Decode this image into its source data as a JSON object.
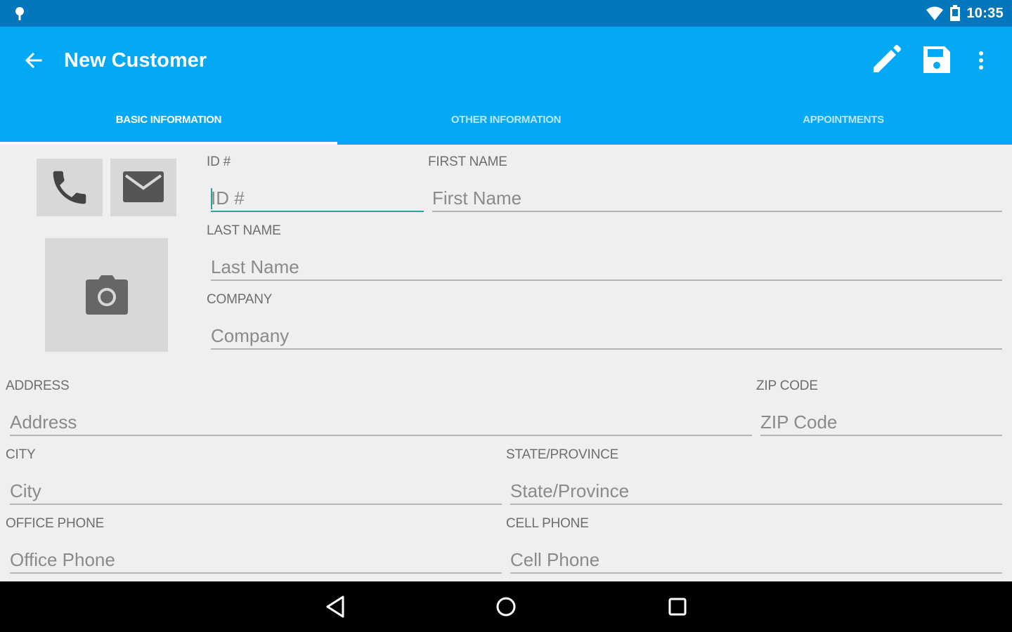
{
  "status_bar": {
    "time": "10:35",
    "icons": [
      "notification-pin-icon",
      "wifi-icon",
      "battery-icon"
    ]
  },
  "app_bar": {
    "title": "New Customer",
    "actions": [
      "back-arrow-icon",
      "pencil-icon",
      "save-icon",
      "more-vert-icon"
    ]
  },
  "tabs": [
    {
      "label": "BASIC INFORMATION",
      "active": true
    },
    {
      "label": "OTHER INFORMATION",
      "active": false
    },
    {
      "label": "APPOINTMENTS",
      "active": false
    }
  ],
  "quick_actions": [
    "phone-icon",
    "email-icon",
    "camera-icon"
  ],
  "form": {
    "id": {
      "label": "ID #",
      "placeholder": "ID #",
      "value": ""
    },
    "first_name": {
      "label": "FIRST NAME",
      "placeholder": "First Name",
      "value": ""
    },
    "last_name": {
      "label": "LAST NAME",
      "placeholder": "Last Name",
      "value": ""
    },
    "company": {
      "label": "COMPANY",
      "placeholder": "Company",
      "value": ""
    },
    "address": {
      "label": "ADDRESS",
      "placeholder": "Address",
      "value": ""
    },
    "zip": {
      "label": "ZIP CODE",
      "placeholder": "ZIP Code",
      "value": ""
    },
    "city": {
      "label": "CITY",
      "placeholder": "City",
      "value": ""
    },
    "state": {
      "label": "STATE/PROVINCE",
      "placeholder": "State/Province",
      "value": ""
    },
    "office_phone": {
      "label": "OFFICE PHONE",
      "placeholder": "Office Phone",
      "value": ""
    },
    "cell_phone": {
      "label": "CELL PHONE",
      "placeholder": "Cell Phone",
      "value": ""
    }
  },
  "nav_bar": [
    "back-triangle-icon",
    "home-circle-icon",
    "recents-square-icon"
  ],
  "colors": {
    "status_bar": "#0277bd",
    "app_bar": "#03a9f4",
    "focus_accent": "#26a69a",
    "background": "#efefef"
  }
}
